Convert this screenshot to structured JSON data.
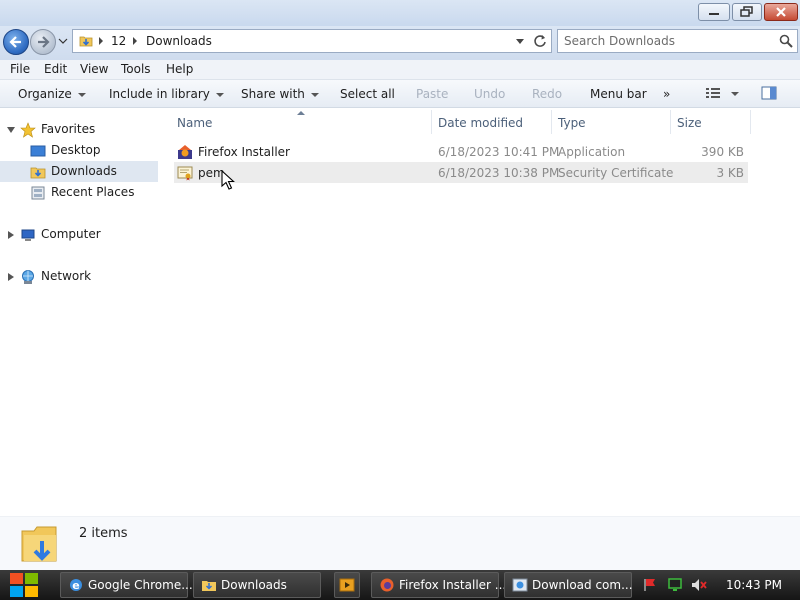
{
  "window": {
    "minimize_icon": "minimize-icon",
    "maximize_icon": "restore-icon",
    "close_icon": "close-icon"
  },
  "address": {
    "breadcrumbs": [
      "12",
      "Downloads"
    ],
    "search_placeholder": "Search Downloads"
  },
  "menubar": {
    "items": [
      "File",
      "Edit",
      "View",
      "Tools",
      "Help"
    ]
  },
  "commandbar": {
    "organize": "Organize",
    "include_in_library": "Include in library",
    "share_with": "Share with",
    "select_all": "Select all",
    "paste": "Paste",
    "undo": "Undo",
    "redo": "Redo",
    "menu_bar": "Menu bar",
    "more": "»"
  },
  "navpane": {
    "favorites": "Favorites",
    "favorites_items": [
      "Desktop",
      "Downloads",
      "Recent Places"
    ],
    "computer": "Computer",
    "network": "Network"
  },
  "columns": {
    "name": "Name",
    "date_modified": "Date modified",
    "type": "Type",
    "size": "Size"
  },
  "files": [
    {
      "name": "Firefox Installer",
      "date": "6/18/2023 10:41 PM",
      "type": "Application",
      "size": "390 KB",
      "icon": "firefox-installer-icon"
    },
    {
      "name": "pem",
      "date": "6/18/2023 10:38 PM",
      "type": "Security Certificate",
      "size": "3 KB",
      "icon": "certificate-icon"
    }
  ],
  "status": {
    "item_count": "2 items"
  },
  "taskbar": {
    "buttons": [
      "Google Chrome...",
      "Downloads",
      "Firefox Installer ...",
      "Download com..."
    ],
    "clock": "10:43 PM"
  },
  "colors": {
    "title_bar": "#c9d9ee",
    "selected_nav": "#dfe7f1",
    "hover_row": "#ececec",
    "close_button": "#c54a33",
    "taskbar": "#151515"
  }
}
